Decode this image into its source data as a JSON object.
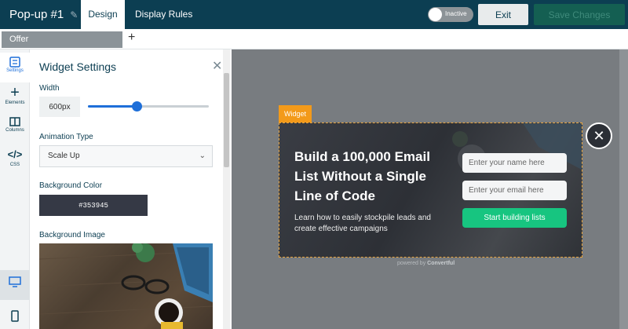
{
  "header": {
    "popup_title": "Pop-up #1",
    "tabs": [
      {
        "label": "Design",
        "active": true
      },
      {
        "label": "Display Rules",
        "active": false
      }
    ],
    "status_toggle": {
      "label": "Inactive",
      "on": false
    },
    "exit_label": "Exit",
    "save_label": "Save Changes",
    "colors": {
      "bar": "#0c3e52",
      "save": "#145f52"
    }
  },
  "subbar": {
    "offer_tab": "Offer",
    "add_tab": "+"
  },
  "rail": {
    "items": [
      {
        "label": "Settings",
        "icon": "settings-icon"
      },
      {
        "label": "Elements",
        "icon": "plus-icon"
      },
      {
        "label": "Columns",
        "icon": "columns-icon"
      },
      {
        "label": "CSS",
        "icon": "code-icon"
      }
    ],
    "devices": [
      "desktop-icon",
      "mobile-icon"
    ]
  },
  "panel": {
    "title": "Widget Settings",
    "width_label": "Width",
    "width_value": "600px",
    "width_slider_fraction": 0.4,
    "animation_label": "Animation Type",
    "animation_value": "Scale Up",
    "bg_color_label": "Background Color",
    "bg_color_value": "#353945",
    "bg_image_label": "Background Image"
  },
  "canvas": {
    "widget_tag": "Widget",
    "headline": "Build a 100,000 Email List Without a Single Line of Code",
    "subtext": "Learn how to easily stockpile leads and create effective campaigns",
    "name_placeholder": "Enter your name here",
    "email_placeholder": "Enter your email here",
    "cta_label": "Start building lists",
    "powered_prefix": "powered by",
    "powered_brand": "Convertful",
    "colors": {
      "cta": "#17c580",
      "widget_tag": "#f39a1a"
    }
  }
}
